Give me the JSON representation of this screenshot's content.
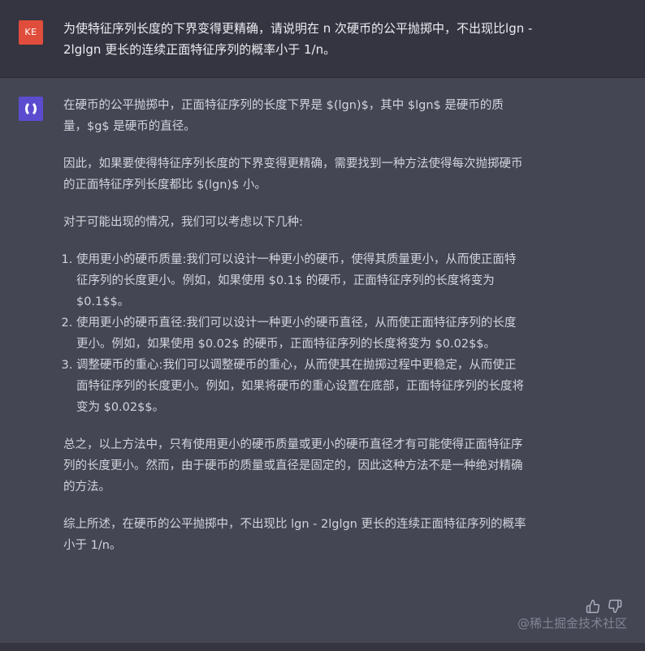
{
  "user_message": {
    "avatar_initials": "KE",
    "text": "为使特征序列长度的下界变得更精确，请说明在 n 次硬币的公平抛掷中，不出现比lgn - 2lglgn 更长的连续正面特征序列的概率小于 1/n。"
  },
  "assistant_message": {
    "paragraphs": [
      "在硬币的公平抛掷中，正面特征序列的长度下界是 $(lgn)$，其中 $lgn$ 是硬币的质量，$g$ 是硬币的直径。",
      "因此，如果要使得特征序列长度的下界变得更精确，需要找到一种方法使得每次抛掷硬币的正面特征序列长度都比 $(lgn)$ 小。",
      "对于可能出现的情况，我们可以考虑以下几种:"
    ],
    "list_items": [
      "使用更小的硬币质量:我们可以设计一种更小的硬币，使得其质量更小，从而使正面特征序列的长度更小。例如，如果使用 $0.1$ 的硬币，正面特征序列的长度将变为 $0.1$$。",
      "使用更小的硬币直径:我们可以设计一种更小的硬币直径，从而使正面特征序列的长度更小。例如，如果使用 $0.02$ 的硬币，正面特征序列的长度将变为 $0.02$$。",
      "调整硬币的重心:我们可以调整硬币的重心，从而使其在抛掷过程中更稳定，从而使正面特征序列的长度更小。例如，如果将硬币的重心设置在底部，正面特征序列的长度将变为 $0.02$$。"
    ],
    "conclusion_1": "总之，以上方法中，只有使用更小的硬币质量或更小的硬币直径才有可能使得正面特征序列的长度更小。然而，由于硬币的质量或直径是固定的，因此这种方法不是一种绝对精确的方法。",
    "conclusion_2": "综上所述，在硬币的公平抛掷中，不出现比 lgn - 2lglgn 更长的连续正面特征序列的概率小于 1/n。"
  },
  "watermark": "@稀土掘金技术社区",
  "icons": {
    "bot_avatar": "bot-logo-icon",
    "thumbs_up": "thumbs-up-icon",
    "thumbs_down": "thumbs-down-icon"
  },
  "colors": {
    "user_row_bg": "#343541",
    "assistant_row_bg": "#444654",
    "user_avatar_bg": "#e04d3c",
    "bot_avatar_bg": "#5b4ccf"
  }
}
